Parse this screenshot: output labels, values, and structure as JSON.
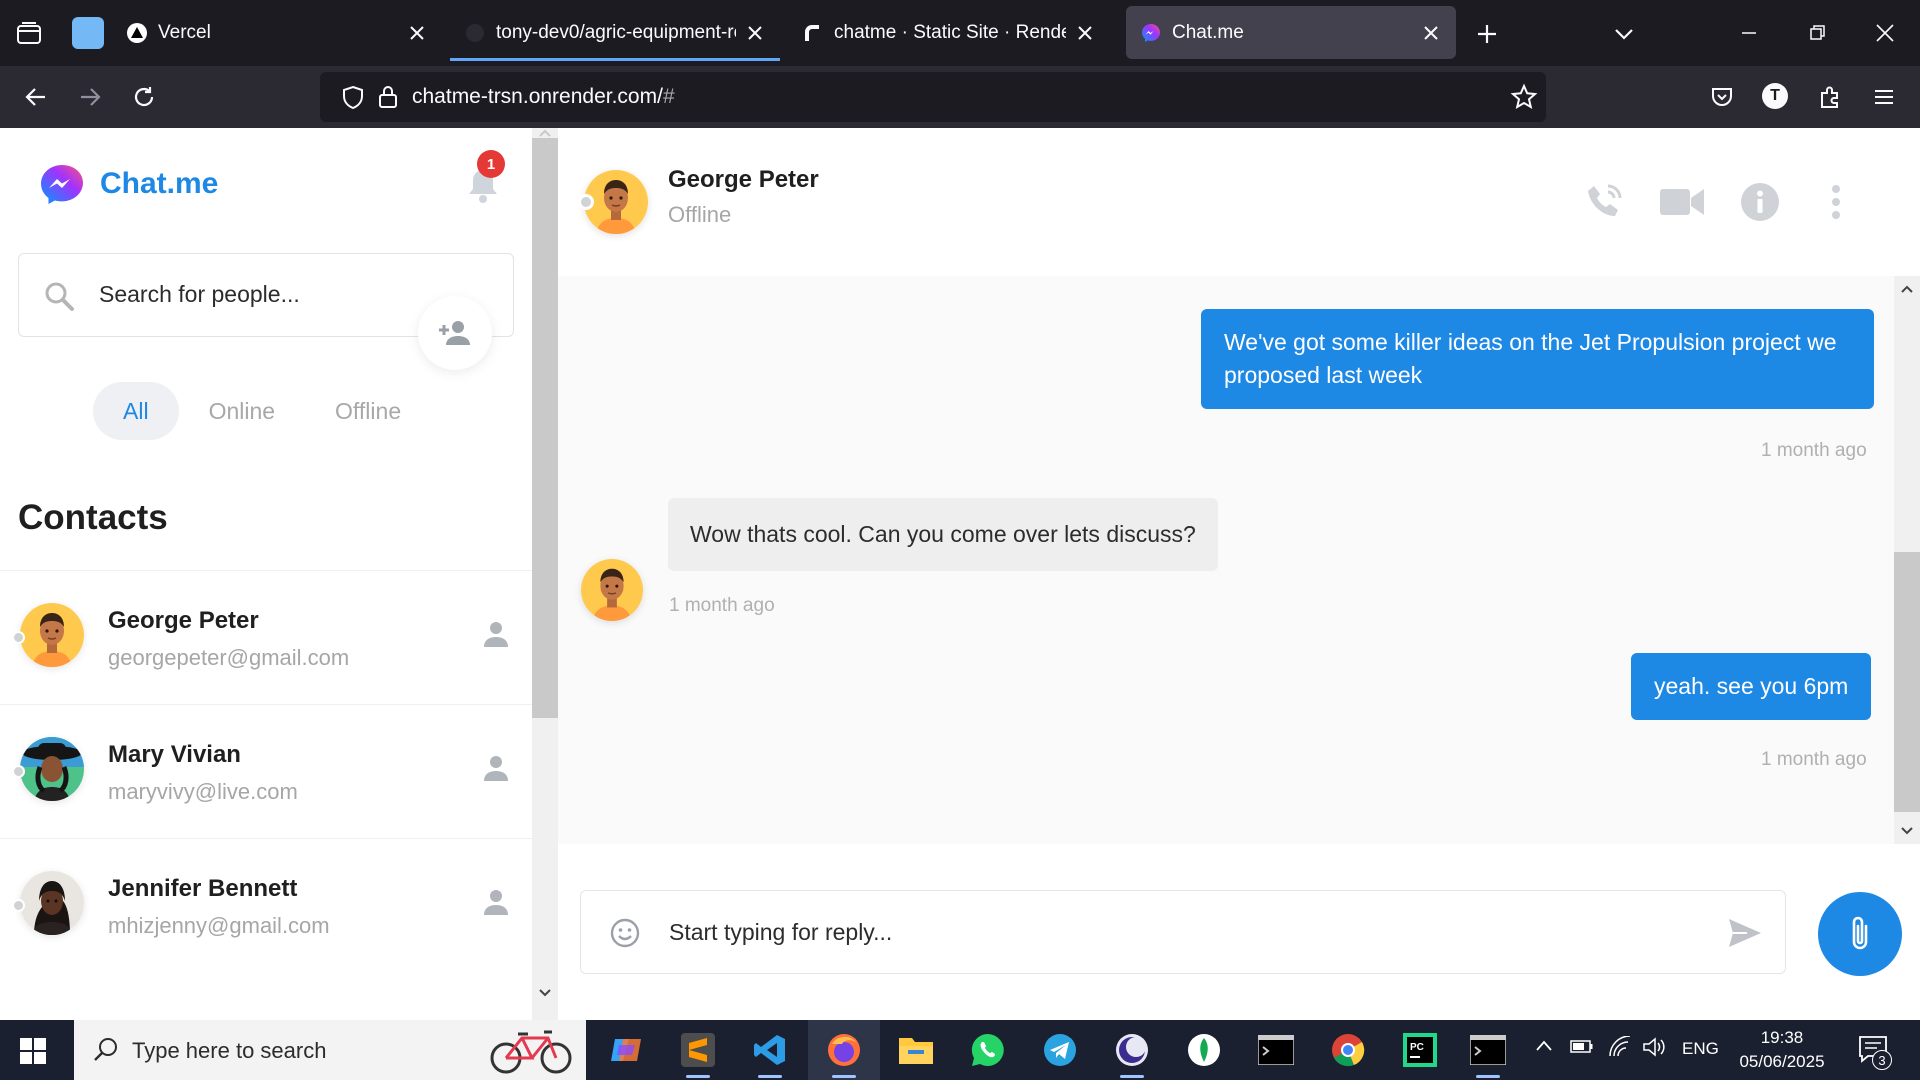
{
  "browser": {
    "tabs": [
      {
        "title": "Vercel",
        "favicon": "vercel-icon"
      },
      {
        "title": "tony-dev0/agric-equipment-ren",
        "favicon": "github-icon"
      },
      {
        "title": "chatme · Static Site · Render",
        "favicon": "render-icon"
      },
      {
        "title": "Chat.me",
        "favicon": "messenger-icon"
      }
    ],
    "url_main": "chatme-trsn.onrender.com/",
    "url_hash": "#",
    "account_initial": "T"
  },
  "app": {
    "brand": "Chat.me",
    "notification_count": "1",
    "search_placeholder": "Search for people...",
    "filters": [
      {
        "label": "All",
        "active": true
      },
      {
        "label": "Online",
        "active": false
      },
      {
        "label": "Offline",
        "active": false
      }
    ],
    "contacts_title": "Contacts",
    "contacts": [
      {
        "name": "George Peter",
        "email": "georgepeter@gmail.com",
        "status": "offline"
      },
      {
        "name": "Mary Vivian",
        "email": "maryvivy@live.com",
        "status": "offline"
      },
      {
        "name": "Jennifer Bennett",
        "email": "mhizjenny@gmail.com",
        "status": "offline"
      }
    ],
    "chat": {
      "name": "George Peter",
      "status": "Offline",
      "messages": [
        {
          "direction": "out",
          "text": "We've got some killer ideas on the Jet Propulsion project we proposed last week",
          "time": "1 month ago"
        },
        {
          "direction": "in",
          "text": "Wow thats cool. Can you come over lets discuss?",
          "time": "1 month ago"
        },
        {
          "direction": "out",
          "text": "yeah. see you 6pm",
          "time": "1 month ago"
        }
      ],
      "reply_placeholder": "Start typing for reply..."
    },
    "colors": {
      "accent": "#1e88e5",
      "badge": "#e53935"
    }
  },
  "taskbar": {
    "search_placeholder": "Type here to search",
    "language": "ENG",
    "time": "19:38",
    "date": "05/06/2025",
    "notification_count": "3"
  }
}
